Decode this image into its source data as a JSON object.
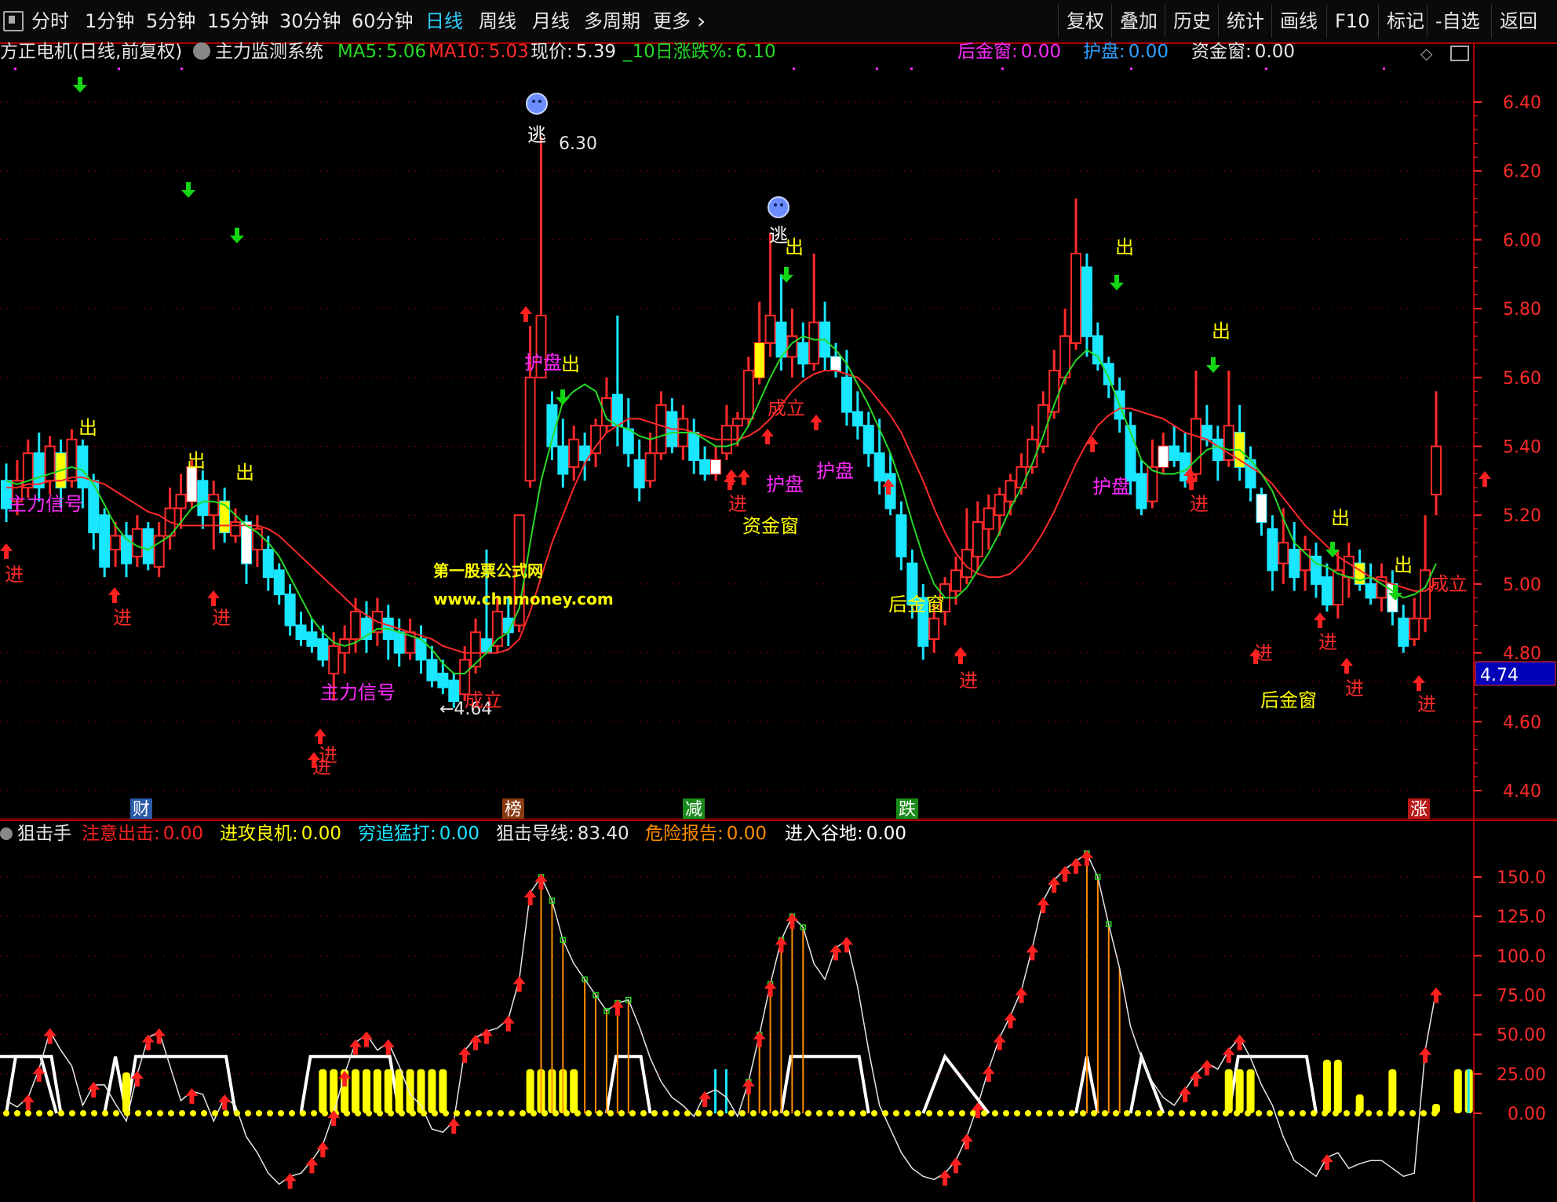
{
  "toolbar": {
    "periods": [
      "分时",
      "1分钟",
      "5分钟",
      "15分钟",
      "30分钟",
      "60分钟",
      "日线",
      "周线",
      "月线",
      "多周期",
      "更多"
    ],
    "active_period": "日线",
    "more_chevron": "›",
    "right_buttons": [
      "复权",
      "叠加",
      "历史",
      "统计",
      "画线",
      "F10",
      "标记",
      "-自选",
      "返回"
    ]
  },
  "main_legend": {
    "stock": "方正电机(日线,前复权)",
    "indicator": "主力监测系统",
    "ma5_label": "MA5:",
    "ma5_value": "5.06",
    "ma10_label": "MA10:",
    "ma10_value": "5.03",
    "price_label": "现价:",
    "price_value": "5.39",
    "chg_label": "_10日涨跌%:",
    "chg_value": "6.10",
    "hjc_label": "后金窗:",
    "hjc_value": "0.00",
    "hp_label": "护盘:",
    "hp_value": "0.00",
    "zjc_label": "资金窗:",
    "zjc_value": "0.00"
  },
  "sub_legend": {
    "name": "狙击手",
    "items": [
      {
        "label": "注意出击:",
        "value": "0.00",
        "color": "#ff2020"
      },
      {
        "label": "进攻良机:",
        "value": "0.00",
        "color": "#ffff00"
      },
      {
        "label": "穷追猛打:",
        "value": "0.00",
        "color": "#19e6ff"
      },
      {
        "label": "狙击导线:",
        "value": "83.40",
        "color": "#e6e6e6"
      },
      {
        "label": "危险报告:",
        "value": "0.00",
        "color": "#ff8c00"
      },
      {
        "label": "进入谷地:",
        "value": "0.00",
        "color": "#ffffff"
      }
    ]
  },
  "price_axis": {
    "ticks": [
      "6.40",
      "6.20",
      "6.00",
      "5.80",
      "5.60",
      "5.40",
      "5.20",
      "5.00",
      "4.80",
      "4.60",
      "4.40"
    ],
    "current_tag": "4.74"
  },
  "sub_axis": {
    "ticks": [
      "150.0",
      "125.0",
      "100.0",
      "75.00",
      "50.00",
      "25.00",
      "0.00"
    ]
  },
  "watermark": {
    "line1": "第一股票公式网",
    "line2": "www.chnmoney.com"
  },
  "event_badges": [
    {
      "text": "财",
      "color": "#2a5aa8"
    },
    {
      "text": "榜",
      "color": "#8a3a10"
    },
    {
      "text": "减",
      "color": "#1a8a1a"
    },
    {
      "text": "跌",
      "color": "#1a8a1a"
    },
    {
      "text": "涨",
      "color": "#b81818"
    }
  ],
  "annotations": {
    "high": "6.30",
    "low": "←4.64",
    "escape": "逃",
    "in": "进",
    "out": "出",
    "main_signal": "主力信号",
    "established": "成立",
    "protect": "护盘",
    "capital_window": "资金窗",
    "later_window": "后金窗"
  },
  "colors": {
    "up": "#ff2a2a",
    "down": "#19e6ff",
    "ma5": "#27d827",
    "ma10": "#ff2a2a",
    "grid": "#7a0000",
    "border": "#b00000",
    "signal_yellow": "#ffff00",
    "arrow_red": "#ff2020",
    "arrow_green": "#13d613",
    "magenta": "#ff2aff"
  },
  "chart_data": {
    "type": "candlestick",
    "title": "方正电机(日线,前复权)",
    "ylim": [
      4.4,
      6.45
    ],
    "candles": [
      [
        5.3,
        5.22,
        5.35,
        5.18
      ],
      [
        5.24,
        5.3,
        5.36,
        5.2
      ],
      [
        5.28,
        5.38,
        5.42,
        5.25
      ],
      [
        5.38,
        5.28,
        5.44,
        5.24
      ],
      [
        5.3,
        5.4,
        5.43,
        5.26
      ],
      [
        5.38,
        5.28,
        5.42,
        5.22
      ],
      [
        5.3,
        5.42,
        5.45,
        5.28
      ],
      [
        5.4,
        5.28,
        5.42,
        5.22
      ],
      [
        5.3,
        5.15,
        5.32,
        5.1
      ],
      [
        5.2,
        5.05,
        5.22,
        5.02
      ],
      [
        5.1,
        5.14,
        5.18,
        5.05
      ],
      [
        5.14,
        5.06,
        5.18,
        5.02
      ],
      [
        5.08,
        5.16,
        5.2,
        5.05
      ],
      [
        5.16,
        5.06,
        5.18,
        5.04
      ],
      [
        5.05,
        5.14,
        5.18,
        5.02
      ],
      [
        5.14,
        5.22,
        5.28,
        5.1
      ],
      [
        5.22,
        5.26,
        5.32,
        5.16
      ],
      [
        5.24,
        5.34,
        5.36,
        5.22
      ],
      [
        5.3,
        5.2,
        5.33,
        5.16
      ],
      [
        5.2,
        5.26,
        5.3,
        5.1
      ],
      [
        5.24,
        5.15,
        5.28,
        5.12
      ],
      [
        5.14,
        5.18,
        5.22,
        5.12
      ],
      [
        5.18,
        5.06,
        5.2,
        5.0
      ],
      [
        5.1,
        5.16,
        5.2,
        5.05
      ],
      [
        5.1,
        5.02,
        5.14,
        4.98
      ],
      [
        5.04,
        4.97,
        5.06,
        4.94
      ],
      [
        4.97,
        4.88,
        5.0,
        4.85
      ],
      [
        4.88,
        4.84,
        4.92,
        4.82
      ],
      [
        4.86,
        4.82,
        4.9,
        4.8
      ],
      [
        4.84,
        4.78,
        4.88,
        4.76
      ],
      [
        4.74,
        4.82,
        4.86,
        4.66
      ],
      [
        4.8,
        4.84,
        4.88,
        4.74
      ],
      [
        4.84,
        4.92,
        4.96,
        4.8
      ],
      [
        4.9,
        4.84,
        4.95,
        4.8
      ],
      [
        4.86,
        4.92,
        4.96,
        4.82
      ],
      [
        4.9,
        4.84,
        4.94,
        4.78
      ],
      [
        4.86,
        4.8,
        4.9,
        4.76
      ],
      [
        4.8,
        4.86,
        4.9,
        4.78
      ],
      [
        4.84,
        4.78,
        4.88,
        4.74
      ],
      [
        4.78,
        4.72,
        4.82,
        4.7
      ],
      [
        4.74,
        4.7,
        4.78,
        4.68
      ],
      [
        4.72,
        4.66,
        4.74,
        4.64
      ],
      [
        4.68,
        4.78,
        4.82,
        4.66
      ],
      [
        4.76,
        4.86,
        4.9,
        4.74
      ],
      [
        4.84,
        4.8,
        5.1,
        4.8
      ],
      [
        4.82,
        4.92,
        4.96,
        4.8
      ],
      [
        4.9,
        4.86,
        4.96,
        4.82
      ],
      [
        4.88,
        5.2,
        5.2,
        4.86
      ],
      [
        5.3,
        5.6,
        5.75,
        5.28
      ],
      [
        5.6,
        5.78,
        6.3,
        5.76
      ],
      [
        5.52,
        5.4,
        5.56,
        5.36
      ],
      [
        5.4,
        5.32,
        5.48,
        5.28
      ],
      [
        5.34,
        5.42,
        5.46,
        5.3
      ],
      [
        5.4,
        5.36,
        5.44,
        5.3
      ],
      [
        5.38,
        5.46,
        5.48,
        5.34
      ],
      [
        5.46,
        5.54,
        5.6,
        5.44
      ],
      [
        5.55,
        5.46,
        5.78,
        5.4
      ],
      [
        5.45,
        5.38,
        5.54,
        5.34
      ],
      [
        5.36,
        5.28,
        5.42,
        5.24
      ],
      [
        5.3,
        5.38,
        5.44,
        5.28
      ],
      [
        5.38,
        5.52,
        5.56,
        5.36
      ],
      [
        5.5,
        5.4,
        5.54,
        5.38
      ],
      [
        5.4,
        5.48,
        5.52,
        5.36
      ],
      [
        5.44,
        5.36,
        5.48,
        5.32
      ],
      [
        5.36,
        5.32,
        5.4,
        5.3
      ],
      [
        5.32,
        5.36,
        5.4,
        5.3
      ],
      [
        5.38,
        5.46,
        5.52,
        5.36
      ],
      [
        5.46,
        5.48,
        5.5,
        5.4
      ],
      [
        5.48,
        5.62,
        5.66,
        5.46
      ],
      [
        5.6,
        5.7,
        5.82,
        5.58
      ],
      [
        5.7,
        5.78,
        6.02,
        5.66
      ],
      [
        5.76,
        5.66,
        5.9,
        5.62
      ],
      [
        5.66,
        5.72,
        5.8,
        5.6
      ],
      [
        5.7,
        5.64,
        5.76,
        5.6
      ],
      [
        5.64,
        5.76,
        5.96,
        5.62
      ],
      [
        5.76,
        5.66,
        5.82,
        5.62
      ],
      [
        5.66,
        5.62,
        5.7,
        5.6
      ],
      [
        5.6,
        5.5,
        5.68,
        5.46
      ],
      [
        5.5,
        5.46,
        5.56,
        5.42
      ],
      [
        5.46,
        5.38,
        5.5,
        5.34
      ],
      [
        5.38,
        5.3,
        5.48,
        5.26
      ],
      [
        5.32,
        5.22,
        5.38,
        5.2
      ],
      [
        5.2,
        5.08,
        5.24,
        5.04
      ],
      [
        5.06,
        4.94,
        5.1,
        4.9
      ],
      [
        4.96,
        4.82,
        5.0,
        4.78
      ],
      [
        4.84,
        4.9,
        4.94,
        4.8
      ],
      [
        4.92,
        5.0,
        5.02,
        4.88
      ],
      [
        4.98,
        5.04,
        5.08,
        4.94
      ],
      [
        5.02,
        5.1,
        5.22,
        5.0
      ],
      [
        5.08,
        5.18,
        5.24,
        5.04
      ],
      [
        5.16,
        5.22,
        5.26,
        5.1
      ],
      [
        5.2,
        5.26,
        5.28,
        5.14
      ],
      [
        5.24,
        5.3,
        5.32,
        5.2
      ],
      [
        5.28,
        5.34,
        5.38,
        5.26
      ],
      [
        5.34,
        5.42,
        5.46,
        5.32
      ],
      [
        5.4,
        5.52,
        5.56,
        5.38
      ],
      [
        5.5,
        5.62,
        5.68,
        5.48
      ],
      [
        5.6,
        5.72,
        5.8,
        5.58
      ],
      [
        5.7,
        5.96,
        6.12,
        5.68
      ],
      [
        5.92,
        5.72,
        5.96,
        5.66
      ],
      [
        5.72,
        5.64,
        5.76,
        5.62
      ],
      [
        5.64,
        5.58,
        5.66,
        5.54
      ],
      [
        5.56,
        5.48,
        5.6,
        5.44
      ],
      [
        5.46,
        5.3,
        5.5,
        5.26
      ],
      [
        5.32,
        5.22,
        5.36,
        5.2
      ],
      [
        5.24,
        5.34,
        5.42,
        5.22
      ],
      [
        5.34,
        5.4,
        5.44,
        5.32
      ],
      [
        5.4,
        5.36,
        5.46,
        5.34
      ],
      [
        5.38,
        5.3,
        5.44,
        5.28
      ],
      [
        5.32,
        5.48,
        5.62,
        5.3
      ],
      [
        5.46,
        5.42,
        5.52,
        5.4
      ],
      [
        5.42,
        5.36,
        5.46,
        5.3
      ],
      [
        5.36,
        5.46,
        5.62,
        5.34
      ],
      [
        5.44,
        5.34,
        5.52,
        5.3
      ],
      [
        5.36,
        5.28,
        5.4,
        5.24
      ],
      [
        5.26,
        5.18,
        5.28,
        5.14
      ],
      [
        5.16,
        5.04,
        5.2,
        4.98
      ],
      [
        5.06,
        5.12,
        5.22,
        5.0
      ],
      [
        5.1,
        5.02,
        5.18,
        4.98
      ],
      [
        5.04,
        5.1,
        5.14,
        4.98
      ],
      [
        5.08,
        5.0,
        5.12,
        4.96
      ],
      [
        5.02,
        4.94,
        5.06,
        4.92
      ],
      [
        4.94,
        5.04,
        5.1,
        4.9
      ],
      [
        5.02,
        5.08,
        5.12,
        4.96
      ],
      [
        5.06,
        5.0,
        5.1,
        4.98
      ],
      [
        5.0,
        4.96,
        5.06,
        4.94
      ],
      [
        4.96,
        5.02,
        5.06,
        4.92
      ],
      [
        5.0,
        4.92,
        5.04,
        4.88
      ],
      [
        4.9,
        4.82,
        4.94,
        4.8
      ],
      [
        4.84,
        4.9,
        4.96,
        4.82
      ],
      [
        4.9,
        5.04,
        5.2,
        4.86
      ],
      [
        5.26,
        5.4,
        5.56,
        5.2
      ]
    ],
    "ma5": [
      5.3,
      5.29,
      5.3,
      5.31,
      5.32,
      5.33,
      5.34,
      5.33,
      5.29,
      5.23,
      5.17,
      5.13,
      5.11,
      5.1,
      5.12,
      5.14,
      5.18,
      5.22,
      5.24,
      5.24,
      5.23,
      5.2,
      5.17,
      5.15,
      5.12,
      5.08,
      5.02,
      4.96,
      4.9,
      4.86,
      4.83,
      4.82,
      4.83,
      4.85,
      4.87,
      4.87,
      4.86,
      4.85,
      4.84,
      4.81,
      4.77,
      4.74,
      4.74,
      4.77,
      4.8,
      4.84,
      4.86,
      4.93,
      5.12,
      5.3,
      5.42,
      5.53,
      5.56,
      5.58,
      5.56,
      5.48,
      5.46,
      5.45,
      5.43,
      5.42,
      5.43,
      5.44,
      5.44,
      5.44,
      5.42,
      5.4,
      5.4,
      5.41,
      5.46,
      5.53,
      5.6,
      5.66,
      5.7,
      5.72,
      5.71,
      5.71,
      5.68,
      5.64,
      5.58,
      5.52,
      5.45,
      5.38,
      5.29,
      5.18,
      5.08,
      5.0,
      4.96,
      4.96,
      4.99,
      5.04,
      5.09,
      5.15,
      5.22,
      5.28,
      5.35,
      5.43,
      5.52,
      5.6,
      5.65,
      5.68,
      5.66,
      5.6,
      5.52,
      5.44,
      5.36,
      5.33,
      5.32,
      5.32,
      5.33,
      5.36,
      5.39,
      5.4,
      5.39,
      5.39,
      5.36,
      5.32,
      5.27,
      5.19,
      5.12,
      5.09,
      5.06,
      5.05,
      5.03,
      5.02,
      5.01,
      5.02,
      5.0,
      4.98,
      4.96,
      4.97,
      4.99,
      5.06
    ],
    "ma10": [
      5.28,
      5.28,
      5.29,
      5.29,
      5.3,
      5.3,
      5.31,
      5.31,
      5.3,
      5.29,
      5.27,
      5.25,
      5.23,
      5.21,
      5.2,
      5.18,
      5.17,
      5.17,
      5.17,
      5.17,
      5.17,
      5.17,
      5.17,
      5.17,
      5.16,
      5.14,
      5.11,
      5.08,
      5.05,
      5.02,
      4.99,
      4.96,
      4.93,
      4.91,
      4.89,
      4.88,
      4.87,
      4.86,
      4.85,
      4.84,
      4.82,
      4.81,
      4.8,
      4.8,
      4.8,
      4.8,
      4.81,
      4.84,
      4.92,
      5.02,
      5.12,
      5.2,
      5.28,
      5.35,
      5.4,
      5.44,
      5.46,
      5.48,
      5.48,
      5.47,
      5.46,
      5.45,
      5.45,
      5.44,
      5.43,
      5.42,
      5.42,
      5.42,
      5.43,
      5.45,
      5.48,
      5.52,
      5.56,
      5.59,
      5.61,
      5.62,
      5.62,
      5.61,
      5.6,
      5.57,
      5.53,
      5.49,
      5.44,
      5.37,
      5.3,
      5.22,
      5.15,
      5.09,
      5.05,
      5.03,
      5.02,
      5.02,
      5.03,
      5.06,
      5.1,
      5.15,
      5.21,
      5.28,
      5.35,
      5.41,
      5.46,
      5.49,
      5.51,
      5.51,
      5.5,
      5.49,
      5.48,
      5.46,
      5.44,
      5.43,
      5.42,
      5.4,
      5.38,
      5.36,
      5.34,
      5.32,
      5.29,
      5.25,
      5.21,
      5.17,
      5.14,
      5.11,
      5.08,
      5.06,
      5.04,
      5.02,
      5.01,
      5.0,
      4.99,
      4.98,
      4.98,
      5.0
    ]
  },
  "sub_chart_data": {
    "type": "line",
    "ylim": [
      -45,
      175
    ],
    "line": [
      8,
      4,
      10,
      28,
      52,
      40,
      30,
      5,
      18,
      18,
      6,
      -5,
      25,
      48,
      52,
      30,
      8,
      14,
      12,
      -5,
      10,
      5,
      -15,
      -25,
      -38,
      -45,
      -40,
      -38,
      -30,
      -20,
      0,
      25,
      45,
      50,
      40,
      45,
      30,
      12,
      5,
      -10,
      -12,
      -5,
      40,
      48,
      52,
      54,
      60,
      85,
      140,
      150,
      135,
      110,
      95,
      85,
      75,
      65,
      70,
      72,
      55,
      35,
      20,
      10,
      5,
      -2,
      12,
      15,
      10,
      -2,
      20,
      50,
      82,
      110,
      125,
      118,
      95,
      85,
      105,
      110,
      80,
      40,
      5,
      -10,
      -25,
      -35,
      -40,
      -42,
      -38,
      -30,
      -15,
      5,
      28,
      48,
      62,
      78,
      105,
      135,
      148,
      155,
      160,
      165,
      150,
      120,
      92,
      55,
      35,
      20,
      10,
      5,
      15,
      25,
      32,
      28,
      40,
      48,
      35,
      18,
      5,
      -15,
      -30,
      -35,
      -40,
      -28,
      -25,
      -35,
      -32,
      -30,
      -30,
      -35,
      -40,
      -38,
      40,
      78
    ]
  }
}
